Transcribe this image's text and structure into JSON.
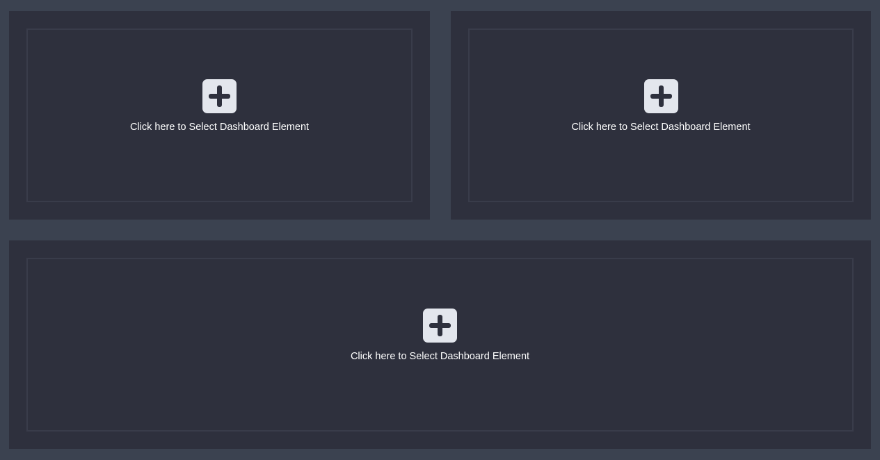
{
  "colors": {
    "background": "#3b4250",
    "panel": "#2e303d",
    "panel_border": "#393c4a",
    "icon_bg": "#e3e6ed",
    "icon_glyph": "#2e303d",
    "text": "#ffffff"
  },
  "panels": [
    {
      "icon": "plus-icon",
      "label": "Click here to Select Dashboard Element"
    },
    {
      "icon": "plus-icon",
      "label": "Click here to Select Dashboard Element"
    },
    {
      "icon": "plus-icon",
      "label": "Click here to Select Dashboard Element"
    }
  ]
}
